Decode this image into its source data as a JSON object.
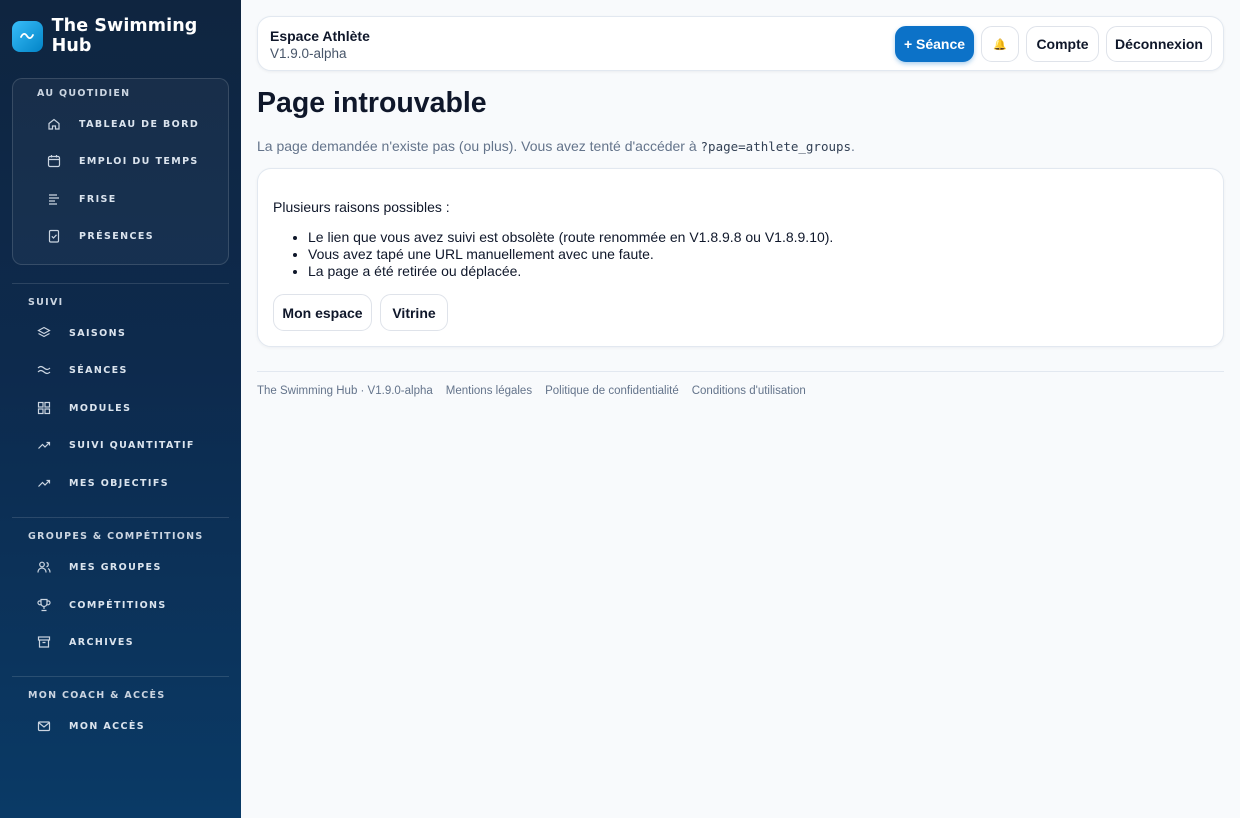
{
  "brand": {
    "title": "The Swimming Hub",
    "logo_icon": "wave-icon"
  },
  "sidebar": {
    "sections": [
      {
        "title": "Au quotidien",
        "items": [
          {
            "label": "Tableau de bord",
            "icon": "home-icon"
          },
          {
            "label": "Emploi du temps",
            "icon": "calendar-icon"
          },
          {
            "label": "Frise",
            "icon": "timeline-icon"
          },
          {
            "label": "Présences",
            "icon": "checklist-icon"
          }
        ]
      },
      {
        "title": "Suivi",
        "items": [
          {
            "label": "Saisons",
            "icon": "layers-icon"
          },
          {
            "label": "Séances",
            "icon": "waves-icon"
          },
          {
            "label": "Modules",
            "icon": "grid-icon"
          },
          {
            "label": "Suivi quantitatif",
            "icon": "trending-up-icon"
          },
          {
            "label": "Mes objectifs",
            "icon": "trending-up-icon"
          }
        ]
      },
      {
        "title": "Groupes & compétitions",
        "items": [
          {
            "label": "Mes groupes",
            "icon": "users-icon"
          },
          {
            "label": "Compétitions",
            "icon": "trophy-icon"
          },
          {
            "label": "Archives",
            "icon": "archive-icon"
          }
        ]
      },
      {
        "title": "Mon coach & accès",
        "items": [
          {
            "label": "Mon accès",
            "icon": "mail-icon"
          }
        ]
      }
    ]
  },
  "topbar": {
    "space_title": "Espace Athlète",
    "version": "V1.9.0-alpha",
    "new_session_label": "+ Séance",
    "notifications_icon": "🔔",
    "account_label": "Compte",
    "logout_label": "Déconnexion"
  },
  "main": {
    "title": "Page introuvable",
    "description_prefix": "La page demandée n'existe pas (ou plus). Vous avez tenté d'accéder à ",
    "requested_route": "?page=athlete_groups",
    "description_suffix": ".",
    "card": {
      "intro": "Plusieurs raisons possibles :",
      "reasons": [
        "Le lien que vous avez suivi est obsolète (route renommée en V1.8.9.8 ou V1.8.9.10).",
        "Vous avez tapé une URL manuellement avec une faute.",
        "La page a été retirée ou déplacée."
      ],
      "my_space_label": "Mon espace",
      "showcase_label": "Vitrine"
    }
  },
  "footer": {
    "app_version": "The Swimming Hub · V1.9.0-alpha",
    "legal": "Mentions légales",
    "privacy": "Politique de confidentialité",
    "terms": "Conditions d'utilisation"
  },
  "colors": {
    "accent": "#0c72c8",
    "sidebar_bg": "#0f2540",
    "page_bg": "#f8fafc"
  }
}
